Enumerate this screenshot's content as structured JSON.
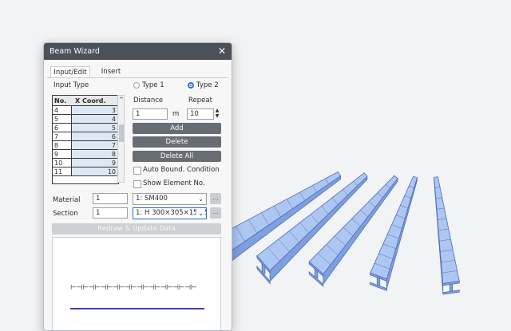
{
  "window": {
    "title": "Beam Wizard"
  },
  "tabs": [
    {
      "label": "Input/Edit",
      "active": true
    },
    {
      "label": "Insert",
      "active": false
    }
  ],
  "input_type": {
    "label": "Input Type",
    "options": [
      {
        "label": "Type 1",
        "selected": false
      },
      {
        "label": "Type 2",
        "selected": true
      }
    ]
  },
  "grid": {
    "headers": [
      "No.",
      "X Coord."
    ],
    "rows": [
      {
        "no": "4",
        "x": "3"
      },
      {
        "no": "5",
        "x": "4"
      },
      {
        "no": "6",
        "x": "5"
      },
      {
        "no": "7",
        "x": "6"
      },
      {
        "no": "8",
        "x": "7"
      },
      {
        "no": "9",
        "x": "8"
      },
      {
        "no": "10",
        "x": "9"
      },
      {
        "no": "11",
        "x": "10"
      }
    ]
  },
  "distance": {
    "label": "Distance",
    "value": "1",
    "unit": "m"
  },
  "repeat": {
    "label": "Repeat",
    "value": "10"
  },
  "buttons": {
    "add": "Add",
    "delete": "Delete",
    "delete_all": "Delete All"
  },
  "checkboxes": {
    "auto_bound": {
      "label": "Auto Bound. Condition",
      "checked": false
    },
    "show_element": {
      "label": "Show Element No.",
      "checked": false
    }
  },
  "material": {
    "label": "Material",
    "number": "1",
    "selected": "1: SM400"
  },
  "section": {
    "label": "Section",
    "number": "1",
    "selected": "1: H 300×305×15/15"
  },
  "redraw": {
    "label": "Redraw & Update Data"
  },
  "preview": {
    "ticks": "⊢⊣⊢⊣⊢⊣⊢⊣⊢⊣⊢⊣⊢⊣⊢⊣⊢⊣⊢⊣⊢"
  },
  "colors": {
    "beam_top": "#aec6f2",
    "beam_side": "#7e9fe0",
    "beam_edge": "#4f6fb8",
    "titlebar": "#4c5157",
    "button": "#686d74",
    "accent": "#2a6fd8"
  }
}
